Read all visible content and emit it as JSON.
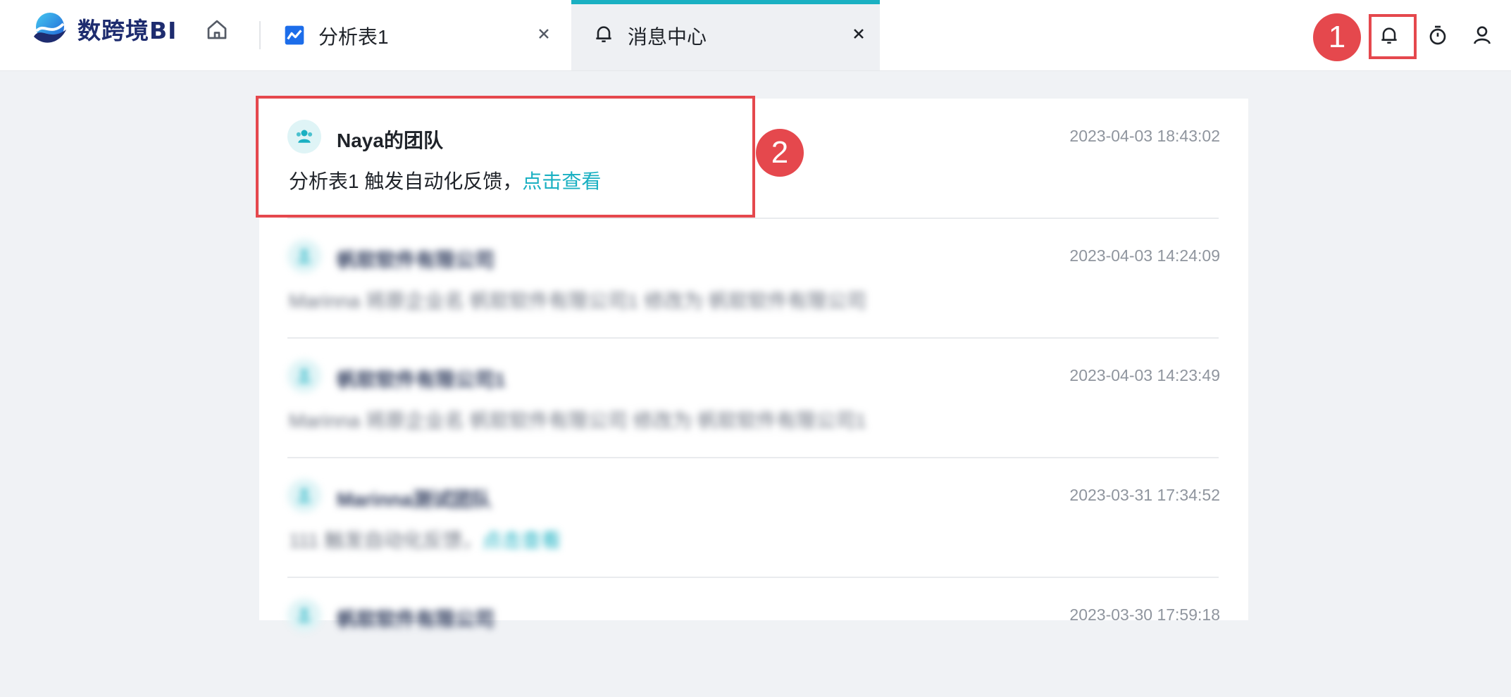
{
  "app": {
    "logo_text": "数跨境BI"
  },
  "tabs": [
    {
      "label": "分析表1",
      "icon": "line-chart-icon",
      "active": false
    },
    {
      "label": "消息中心",
      "icon": "bell-icon",
      "active": true
    }
  ],
  "header_icons": [
    "bell-icon",
    "timer-icon",
    "user-icon"
  ],
  "annotations": {
    "badge1": "1",
    "badge2": "2"
  },
  "messages": [
    {
      "title": "Naya的团队",
      "body": "分析表1 触发自动化反馈，",
      "link": "点击查看",
      "time": "2023-04-03 18:43:02",
      "blurred": false
    },
    {
      "title": "帆软软件有限公司",
      "body": "Marinna 将原企业名 帆软软件有限公司1 修改为 帆软软件有限公司",
      "link": "",
      "time": "2023-04-03 14:24:09",
      "blurred": true
    },
    {
      "title": "帆软软件有限公司1",
      "body": "Marinna 将原企业名 帆软软件有限公司 修改为 帆软软件有限公司1",
      "link": "",
      "time": "2023-04-03 14:23:49",
      "blurred": true
    },
    {
      "title": "Marinna测试团队",
      "body": "111 触发自动化反馈，",
      "link": "点击查看",
      "time": "2023-03-31 17:34:52",
      "blurred": true
    },
    {
      "title": "帆软软件有限公司",
      "body": "",
      "link": "",
      "time": "2023-03-30 17:59:18",
      "blurred": true
    }
  ],
  "colors": {
    "accent": "#1ab0c2",
    "annotation_red": "#e5484d",
    "brand_navy": "#1e2c6f"
  }
}
